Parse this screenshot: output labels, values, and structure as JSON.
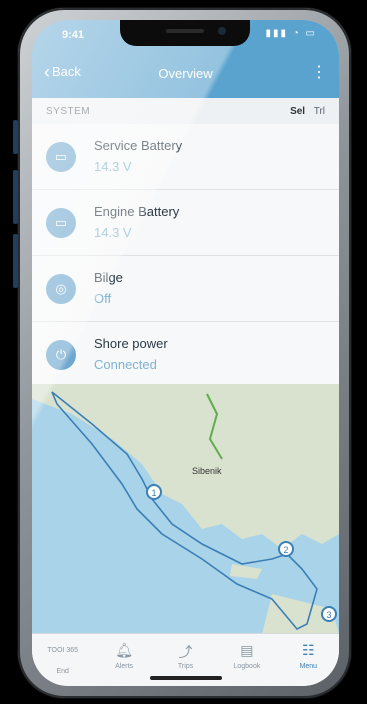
{
  "status_bar": {
    "time": "9:41",
    "icons": "▮▮▮ ◔ ▭"
  },
  "nav": {
    "back_label": "Back",
    "title": "Overview",
    "menu_icon": "more-vertical-icon"
  },
  "system": {
    "label": "SYSTEM",
    "unit_selected": "Sel",
    "unit_other": "Trl",
    "rows": [
      {
        "name": "Service Battery",
        "value": "14.3 V",
        "icon": "battery-icon"
      },
      {
        "name": "Engine Battery",
        "value": "14.3 V",
        "icon": "battery-icon"
      },
      {
        "name": "Bilge",
        "value": "Off",
        "icon": "bilge-icon"
      },
      {
        "name": "Shore power",
        "value": "Connected",
        "icon": "plug-icon"
      }
    ]
  },
  "map": {
    "place_label": "Sibenik",
    "waypoints": [
      "1",
      "2",
      "3"
    ],
    "colors": {
      "water": "#a9d3e8",
      "land": "#d8e2cf",
      "route": "#3a7fb6",
      "green_route": "#5fae4a"
    }
  },
  "tabbar": {
    "tabs": [
      {
        "label": "End",
        "icon": "end-icon",
        "top": "TOOI 365"
      },
      {
        "label": "Alerts",
        "icon": "bell-icon"
      },
      {
        "label": "Trips",
        "icon": "route-icon"
      },
      {
        "label": "Logbook",
        "icon": "logbook-icon"
      },
      {
        "label": "Menu",
        "icon": "grid-icon"
      }
    ]
  },
  "colors": {
    "accent": "#5ba3cf",
    "value_text": "#7fb3d5"
  }
}
